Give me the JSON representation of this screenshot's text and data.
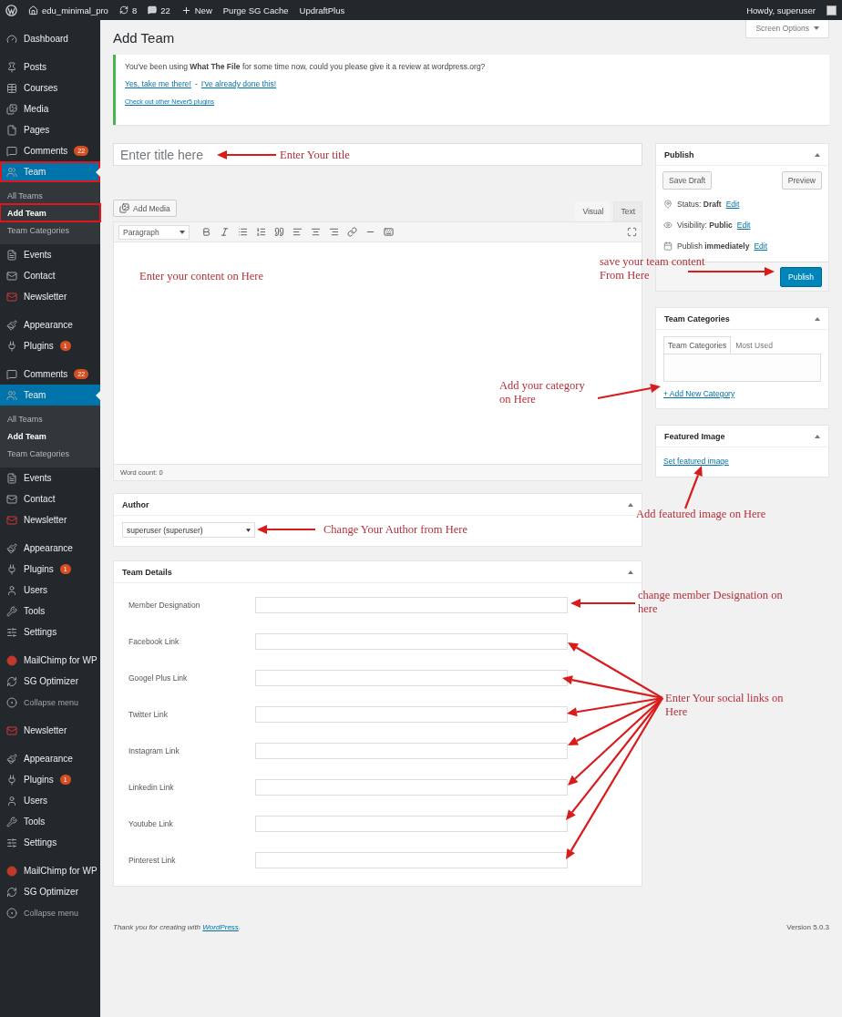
{
  "admin_bar": {
    "site": "edu_minimal_pro",
    "updates": "8",
    "comments": "22",
    "new": "New",
    "links": [
      "Purge SG Cache",
      "UpdraftPlus"
    ],
    "greeting": "Howdy, superuser"
  },
  "sidebar": {
    "groups": [
      [
        {
          "kind": "dashboard",
          "label": "Dashboard",
          "selected": false,
          "highlighted": false
        }
      ],
      [
        {
          "kind": "posts",
          "label": "Posts",
          "selected": false,
          "highlighted": false
        },
        {
          "kind": "courses",
          "label": "Courses",
          "selected": false,
          "highlighted": false
        },
        {
          "kind": "media",
          "label": "Media",
          "selected": false,
          "highlighted": false
        },
        {
          "kind": "pages",
          "label": "Pages",
          "selected": false,
          "highlighted": false
        },
        {
          "kind": "comments",
          "label": "Comments",
          "badge": "22",
          "selected": false,
          "highlighted": false
        },
        {
          "kind": "team",
          "label": "Team",
          "selected": true,
          "highlighted": true,
          "children": [
            {
              "label": "All Teams",
              "selected": false,
              "highlighted": false
            },
            {
              "label": "Add Team",
              "selected": true,
              "highlighted": true
            },
            {
              "label": "Team Categories",
              "selected": false,
              "highlighted": false
            }
          ]
        },
        {
          "kind": "events",
          "label": "Events",
          "selected": false,
          "highlighted": false
        },
        {
          "kind": "contact",
          "label": "Contact",
          "selected": false,
          "highlighted": false
        },
        {
          "kind": "newsletter",
          "label": "Newsletter",
          "selected": false,
          "highlighted": false
        }
      ],
      [
        {
          "kind": "appearance",
          "label": "Appearance",
          "selected": false,
          "highlighted": false
        },
        {
          "kind": "plugins",
          "label": "Plugins",
          "badge": "1",
          "selected": false,
          "highlighted": false
        }
      ],
      [
        {
          "kind": "comments",
          "label": "Comments",
          "badge": "22",
          "selected": false,
          "highlighted": false
        },
        {
          "kind": "team",
          "label": "Team",
          "selected": true,
          "highlighted": false,
          "children": [
            {
              "label": "All Teams",
              "selected": false,
              "highlighted": false
            },
            {
              "label": "Add Team",
              "selected": true,
              "highlighted": false
            },
            {
              "label": "Team Categories",
              "selected": false,
              "highlighted": false
            }
          ]
        },
        {
          "kind": "events",
          "label": "Events",
          "selected": false,
          "highlighted": false
        },
        {
          "kind": "contact",
          "label": "Contact",
          "selected": false,
          "highlighted": false
        },
        {
          "kind": "newsletter",
          "label": "Newsletter",
          "selected": false,
          "highlighted": false
        }
      ],
      [
        {
          "kind": "appearance",
          "label": "Appearance",
          "selected": false,
          "highlighted": false
        },
        {
          "kind": "plugins",
          "label": "Plugins",
          "badge": "1",
          "selected": false,
          "highlighted": false
        },
        {
          "kind": "users",
          "label": "Users",
          "selected": false,
          "highlighted": false
        },
        {
          "kind": "tools",
          "label": "Tools",
          "selected": false,
          "highlighted": false
        },
        {
          "kind": "settings",
          "label": "Settings",
          "selected": false,
          "highlighted": false
        }
      ],
      [
        {
          "kind": "mailchimp",
          "label": "MailChimp for WP",
          "selected": false,
          "highlighted": false
        },
        {
          "kind": "optimizer",
          "label": "SG Optimizer",
          "selected": false,
          "highlighted": false
        },
        {
          "kind": "collapse",
          "label": "Collapse menu",
          "selected": false,
          "highlighted": false
        }
      ],
      [
        {
          "kind": "newsletter",
          "label": "Newsletter",
          "selected": false,
          "highlighted": false
        }
      ],
      [
        {
          "kind": "appearance",
          "label": "Appearance",
          "selected": false,
          "highlighted": false
        },
        {
          "kind": "plugins",
          "label": "Plugins",
          "badge": "1",
          "selected": false,
          "highlighted": false
        },
        {
          "kind": "users",
          "label": "Users",
          "selected": false,
          "highlighted": false
        },
        {
          "kind": "tools",
          "label": "Tools",
          "selected": false,
          "highlighted": false
        },
        {
          "kind": "settings",
          "label": "Settings",
          "selected": false,
          "highlighted": false
        }
      ],
      [
        {
          "kind": "mailchimp",
          "label": "MailChimp for WP",
          "selected": false,
          "highlighted": false
        },
        {
          "kind": "optimizer",
          "label": "SG Optimizer",
          "selected": false,
          "highlighted": false
        },
        {
          "kind": "collapse",
          "label": "Collapse menu",
          "selected": false,
          "highlighted": false
        }
      ]
    ]
  },
  "screen_options": "Screen Options",
  "page_title": "Add Team",
  "notice": {
    "message": "You've been using **What The File** for some time now, could you please give it a review at wordpress.org?",
    "links": [
      "Yes, take me there!",
      "I've already done this!"
    ],
    "separator": "-",
    "footer_link": "Check out other Never5 plugins"
  },
  "title_field": {
    "placeholder": "Enter title here"
  },
  "editor": {
    "add_media": "Add Media",
    "tabs": [
      {
        "label": "Visual",
        "selected": true
      },
      {
        "label": "Text",
        "selected": false
      }
    ],
    "format": "Paragraph",
    "word_count": "Word count: 0"
  },
  "author": {
    "title": "Author",
    "value": "superuser (superuser)"
  },
  "team_details": {
    "title": "Team Details",
    "fields": [
      {
        "label": "Member Designation"
      },
      {
        "label": "Facebook Link"
      },
      {
        "label": "Googel Plus Link"
      },
      {
        "label": "Twitter Link"
      },
      {
        "label": "Instagram Link"
      },
      {
        "label": "Linkedin Link"
      },
      {
        "label": "Youtube Link"
      },
      {
        "label": "Pinterest Link"
      }
    ]
  },
  "publish": {
    "title": "Publish",
    "save_draft": "Save Draft",
    "preview": "Preview",
    "rows": [
      {
        "kind": "status",
        "text": "Status: **Draft**",
        "link": "Edit"
      },
      {
        "kind": "visibility",
        "text": "Visibility: **Public**",
        "link": "Edit"
      },
      {
        "kind": "schedule",
        "text": "Publish **immediately**",
        "link": "Edit"
      }
    ],
    "button": "Publish"
  },
  "categories": {
    "title": "Team Categories",
    "tabs": [
      {
        "label": "Team Categories",
        "selected": true
      },
      {
        "label": "Most Used",
        "selected": false
      }
    ],
    "add_link": "+ Add New Category"
  },
  "featured": {
    "title": "Featured Image",
    "link": "Set featured image"
  },
  "footer": {
    "thanks": "Thank you for creating with",
    "link": "WordPress",
    "period": ".",
    "version": "Version 5.0.3"
  },
  "annotations": [
    "Enter Your title",
    "Enter your content on Here",
    "save your team content From Here",
    "Add your category on Here",
    "Add featured image on Here",
    "Change Your Author from Here",
    "change member Designation on here",
    "Enter Your social links on Here"
  ]
}
